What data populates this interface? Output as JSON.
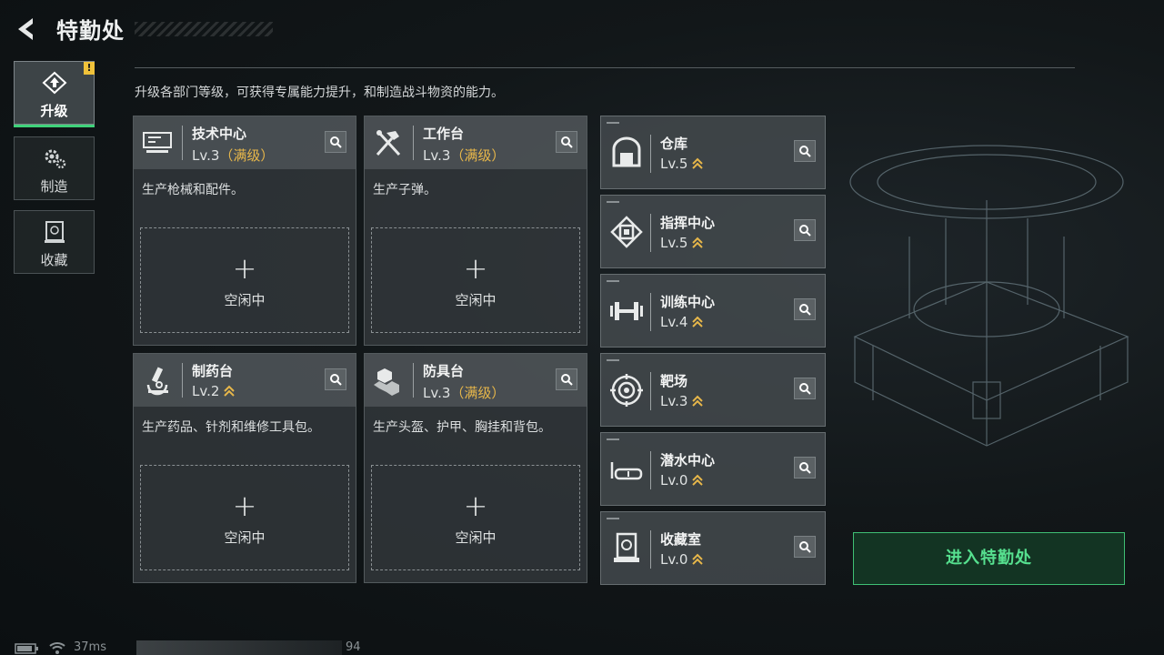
{
  "header": {
    "title": "特勤处"
  },
  "nav": [
    {
      "label": "升级",
      "icon": "upgrade-icon",
      "active": true
    },
    {
      "label": "制造",
      "icon": "gears-icon",
      "active": false
    },
    {
      "label": "收藏",
      "icon": "collection-icon",
      "active": false
    }
  ],
  "nav_badge": "!",
  "description": "升级各部门等级，可获得专属能力提升，和制造战斗物资的能力。",
  "cards": [
    {
      "name": "技术中心",
      "level": "Lv.3",
      "max": "（满级）",
      "desc": "生产枪械和配件。",
      "slot_plus": "+",
      "slot_label": "空闲中",
      "icon": "tech-center-icon"
    },
    {
      "name": "工作台",
      "level": "Lv.3",
      "max": "（满级）",
      "desc": "生产子弹。",
      "slot_plus": "+",
      "slot_label": "空闲中",
      "icon": "workbench-icon"
    },
    {
      "name": "制药台",
      "level": "Lv.2",
      "max": "",
      "desc": "生产药品、针剂和维修工具包。",
      "slot_plus": "+",
      "slot_label": "空闲中",
      "icon": "microscope-icon"
    },
    {
      "name": "防具台",
      "level": "Lv.3",
      "max": "（满级）",
      "desc": "生产头盔、护甲、胸挂和背包。",
      "slot_plus": "+",
      "slot_label": "空闲中",
      "icon": "armor-bench-icon"
    }
  ],
  "facilities": [
    {
      "name": "仓库",
      "level": "Lv.5",
      "icon": "warehouse-icon"
    },
    {
      "name": "指挥中心",
      "level": "Lv.5",
      "icon": "chip-icon"
    },
    {
      "name": "训练中心",
      "level": "Lv.4",
      "icon": "dumbbell-icon"
    },
    {
      "name": "靶场",
      "level": "Lv.3",
      "icon": "target-icon"
    },
    {
      "name": "潜水中心",
      "level": "Lv.0",
      "icon": "goggles-icon"
    },
    {
      "name": "收藏室",
      "level": "Lv.0",
      "icon": "display-case-icon"
    }
  ],
  "enter_button": "进入特勤处",
  "status": {
    "ping": "37ms",
    "number": "94"
  },
  "colors": {
    "accent_green": "#3fd27a",
    "max_level": "#e7b74a",
    "warning": "#f0c23a"
  }
}
